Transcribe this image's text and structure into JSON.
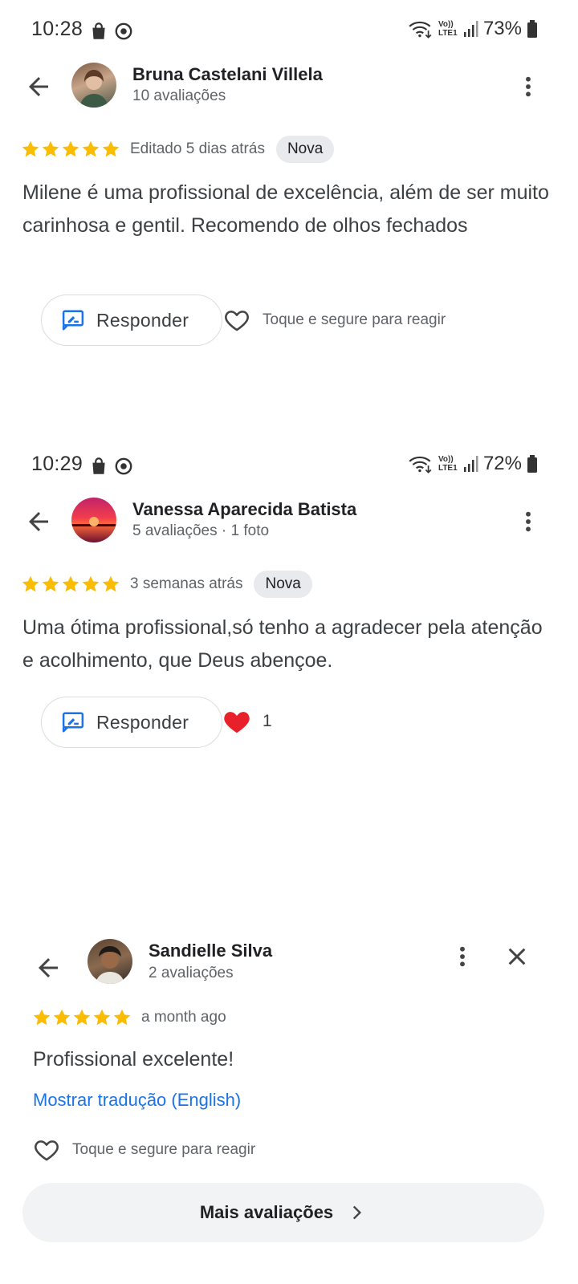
{
  "screens": [
    {
      "status": {
        "time": "10:28",
        "battery": "73%",
        "network": "Vo)) LTE1"
      },
      "reviewer": {
        "name": "Bruna Castelani Villela",
        "subtitle": "10 avaliações"
      },
      "rating": 5,
      "when": "Editado 5 dias atrás",
      "badge": "Nova",
      "text": "Milene é uma profissional de excelência, além de ser muito carinhosa e gentil. Recomendo de olhos fechados",
      "reply_label": "Responder",
      "reaction_hint": "Toque e segure para reagir"
    },
    {
      "status": {
        "time": "10:29",
        "battery": "72%",
        "network": "Vo)) LTE1"
      },
      "reviewer": {
        "name": "Vanessa Aparecida Batista",
        "subtitle": "5 avaliações · 1 foto"
      },
      "rating": 5,
      "when": "3 semanas atrás",
      "badge": "Nova",
      "text": "Uma ótima profissional,só tenho a agradecer pela atenção e acolhimento, que Deus abençoe.",
      "reply_label": "Responder",
      "reaction_count": "1"
    },
    {
      "reviewer": {
        "name": "Sandielle Silva",
        "subtitle": "2 avaliações"
      },
      "rating": 5,
      "when": "a month ago",
      "text": "Profissional excelente!",
      "translate_link": "Mostrar tradução (English)",
      "reaction_hint": "Toque e segure para reagir",
      "more_reviews_label": "Mais avaliações"
    }
  ],
  "colors": {
    "star": "#fbbc04",
    "link": "#1a73e8",
    "heart": "#e8202a",
    "reply_icon": "#1a73e8"
  }
}
